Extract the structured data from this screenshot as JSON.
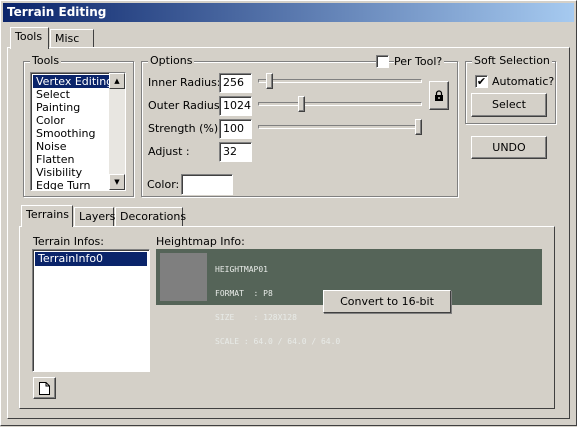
{
  "window": {
    "title": "Terrain Editing"
  },
  "tabs": [
    {
      "label": "Tools"
    },
    {
      "label": "Misc"
    }
  ],
  "tools": {
    "group_label": "Tools",
    "items": [
      "Vertex Editing",
      "Select",
      "Painting",
      "Color",
      "Smoothing",
      "Noise",
      "Flatten",
      "Visibility",
      "Edge Turn"
    ],
    "selected": "Vertex Editing"
  },
  "options": {
    "group_label": "Options",
    "per_tool_label": "Per Tool?",
    "per_tool_checked": false,
    "inner_radius": {
      "label": "Inner Radius:",
      "value": "256"
    },
    "outer_radius": {
      "label": "Outer Radius:",
      "value": "1024"
    },
    "strength": {
      "label": "Strength (%):",
      "value": "100"
    },
    "adjust": {
      "label": "Adjust :",
      "value": "32"
    },
    "color_label": "Color:",
    "color_value": "#ffffff",
    "lock_icon": "lock-icon"
  },
  "soft_selection": {
    "group_label": "Soft Selection",
    "automatic_label": "Automatic?",
    "automatic_checked": true,
    "select_label": "Select"
  },
  "undo_label": "UNDO",
  "subtabs": [
    {
      "label": "Terrains"
    },
    {
      "label": "Layers"
    },
    {
      "label": "Decorations"
    }
  ],
  "terrain_infos": {
    "label": "Terrain Infos:",
    "items": [
      "TerrainInfo0"
    ],
    "selected": "TerrainInfo0"
  },
  "heightmap_info": {
    "label": "Heightmap Info:",
    "name": "HEIGHTMAP01",
    "format": "FORMAT  : P8",
    "size": "SIZE    : 128X128",
    "scale": "SCALE : 64.0 / 64.0 / 64.0",
    "panel_color": "#556458",
    "thumb_color": "#7f7f7f"
  },
  "context_menu": {
    "item": "Convert to 16-bit"
  },
  "new_icon": "new-document-icon"
}
